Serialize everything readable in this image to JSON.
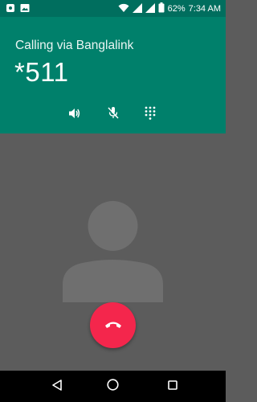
{
  "status_bar": {
    "battery_percent": "62%",
    "time": "7:34 AM",
    "left_icons": [
      "notification-dot-icon",
      "image-icon"
    ],
    "right_icons": [
      "wifi-icon",
      "signal-icon",
      "signal-icon",
      "battery-icon"
    ]
  },
  "call": {
    "calling_label": "Calling via Banglalink",
    "number": "*511"
  },
  "actions": [
    {
      "name": "speaker-icon"
    },
    {
      "name": "mute-mic-icon"
    },
    {
      "name": "dialpad-icon"
    }
  ],
  "colors": {
    "header": "#00806b",
    "status_bar": "#006e5e",
    "body": "#5c5c5c",
    "avatar": "#6f6f6f",
    "end_call": "#f4264c"
  },
  "nav": [
    "back-icon",
    "home-icon",
    "recents-icon"
  ]
}
